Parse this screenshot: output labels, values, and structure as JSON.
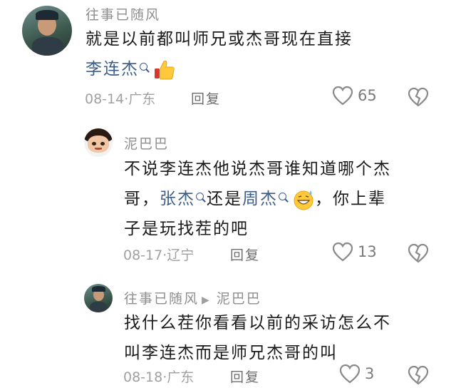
{
  "comments": [
    {
      "username": "往事已随风",
      "text_line1": "就是以前都叫师兄或杰哥现在直接",
      "mention": "李连杰",
      "date": "08-14",
      "location": "广东",
      "reply_label": "回复",
      "likes": "65"
    },
    {
      "username": "泥巴巴",
      "text_line1": "不说李连杰他说杰哥谁知道哪个杰",
      "text_line2_a": "哥，",
      "mention_a": "张杰",
      "text_line2_b": "还是",
      "mention_b": "周杰",
      "text_line2_c": "，你上辈",
      "text_line3": "子是玩找茬的吧",
      "date": "08-17",
      "location": "辽宁",
      "reply_label": "回复",
      "likes": "13"
    },
    {
      "username": "往事已随风",
      "reply_to": "泥巴巴",
      "text_line1": "找什么茬你看看以前的采访怎么不",
      "text_line2": "叫李连杰而是师兄杰哥的叫",
      "date": "08-18",
      "location": "广东",
      "reply_label": "回复",
      "likes": "3"
    }
  ],
  "icons": {
    "like": "heart-outline-icon",
    "dislike": "broken-heart-icon",
    "search": "search-icon",
    "reply_arrow": "triangle-right-icon"
  },
  "colors": {
    "mention": "#3c5d8a",
    "meta": "#a0a0a0",
    "username": "#8e8e8e"
  }
}
